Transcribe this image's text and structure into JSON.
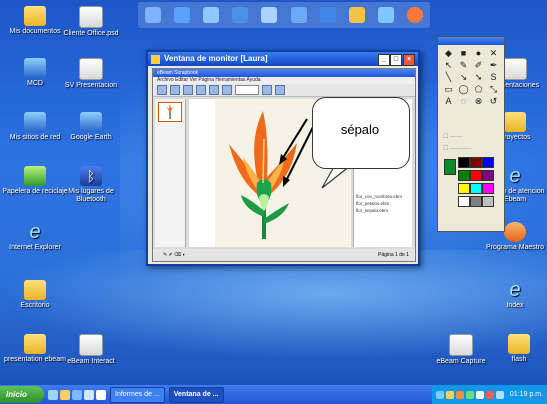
{
  "desktop_icons_left": [
    {
      "label": "Mis documentos"
    },
    {
      "label": "MCD"
    },
    {
      "label": "Mis sitios de red"
    },
    {
      "label": "Papelera de reciclaje"
    },
    {
      "label": "Internet Explorer"
    },
    {
      "label": "Escritorio"
    },
    {
      "label": "presentation ebeam"
    }
  ],
  "desktop_icons_second": [
    {
      "label": "Cliente Office.psd"
    },
    {
      "label": "SV Presentacion"
    },
    {
      "label": "Google Earth"
    },
    {
      "label": "Mis lugares de Bluetooth"
    },
    {
      "label": "eBeam Interact"
    }
  ],
  "desktop_icons_right": [
    {
      "label": "Presentaciones"
    },
    {
      "label": "Proyectos"
    },
    {
      "label": "Centro de atencion Ebeam"
    },
    {
      "label": "Programa Maestro"
    },
    {
      "label": "Index"
    },
    {
      "label": "eBeam Capture"
    },
    {
      "label": "flash"
    }
  ],
  "monitor_window": {
    "title": "Ventana de monitor [Laura]",
    "inner_title": "eBeam Scrapbook",
    "menu": "Archivo  Editar  Ver  Página  Herramientas  Ayuda",
    "page_box": "1 de 1",
    "status": "Página 1 de 1",
    "files": [
      "flor_con_nombres.ebm",
      "flor_petalos.ebm",
      "flor_sepalo.ebm"
    ]
  },
  "callout": {
    "text": "sépalo"
  },
  "taskbar": {
    "start": "Inicio",
    "tasks": [
      "Informes de ...",
      "Ventana de ..."
    ],
    "clock": "01:19 p.m."
  },
  "colors": {
    "palette_swatches": [
      "#000000",
      "#800000",
      "#0000ff",
      "#008000",
      "#ff0000",
      "#800080",
      "#ffff00",
      "#00ffff",
      "#ff00ff",
      "#ffffff",
      "#808080",
      "#c0c0c0"
    ],
    "selected_color": "#0a8a2a"
  }
}
